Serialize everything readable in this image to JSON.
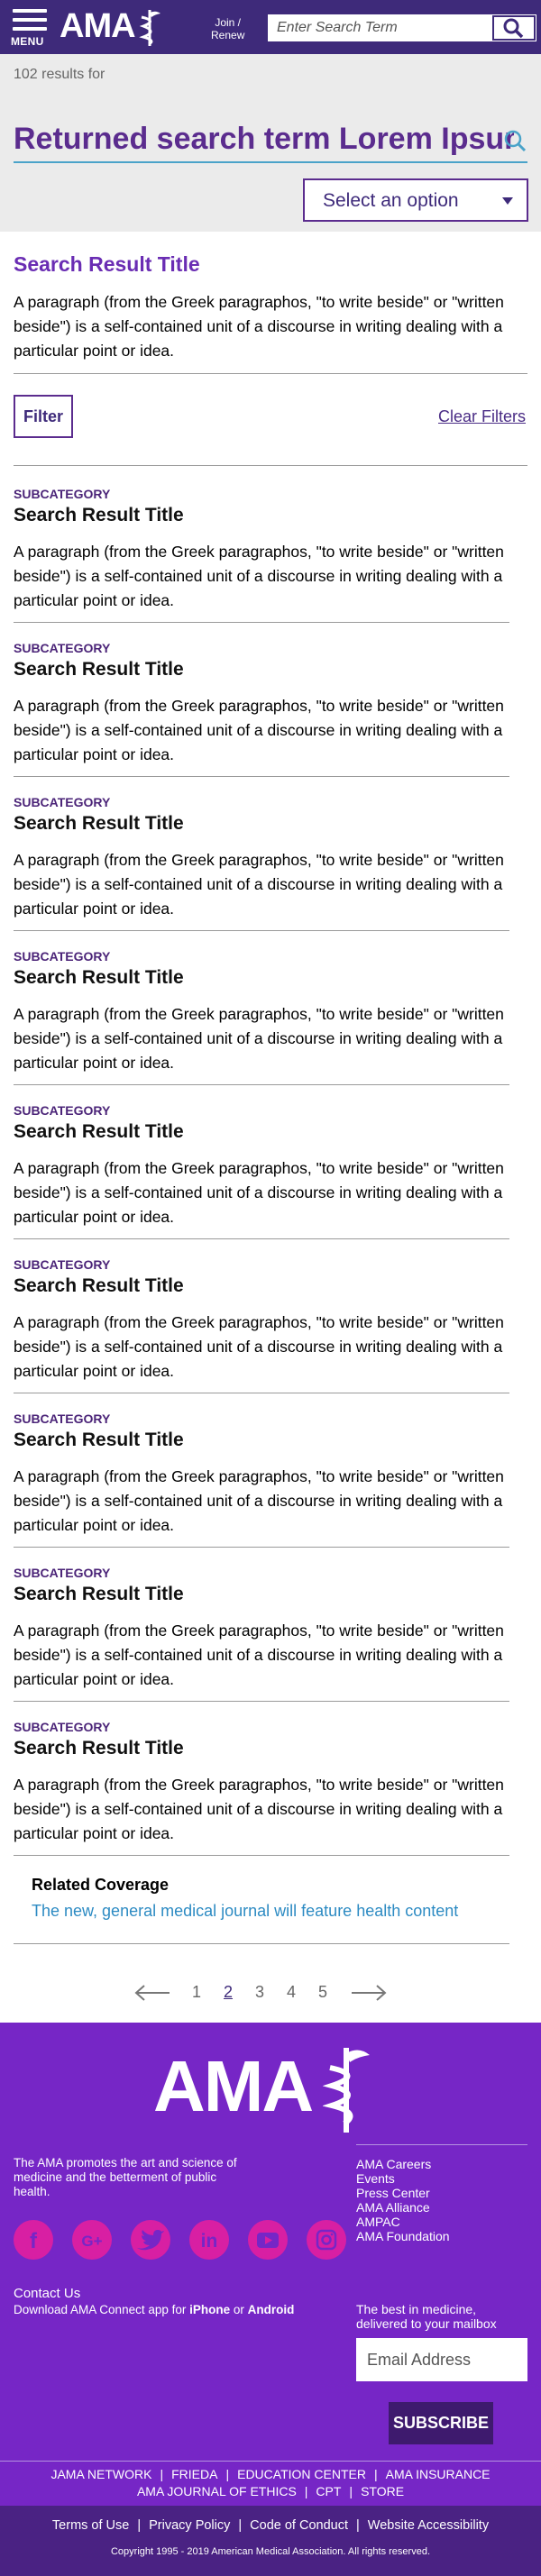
{
  "header": {
    "menu_label": "MENU",
    "logo_text": "AMA",
    "join_line1": "Join /",
    "join_line2": "Renew",
    "search_placeholder": "Enter Search Term"
  },
  "results_header": {
    "count_text": "102 results for",
    "query": "Returned search term Lorem Ipsum",
    "sort_select": "Select an option"
  },
  "featured": {
    "title": "Search Result Title",
    "body": "A paragraph (from the Greek paragraphos, \"to write beside\" or \"written beside\") is a self-contained unit of a discourse in writing dealing with a particular point or idea."
  },
  "filters": {
    "filter_label": "Filter",
    "clear_label": "Clear Filters"
  },
  "results": [
    {
      "subcategory": "SUBCATEGORY",
      "title": "Search Result Title",
      "body": "A paragraph (from the Greek paragraphos, \"to write beside\" or \"written beside\") is a self-contained unit of a discourse in writing dealing with a particular point or idea."
    },
    {
      "subcategory": "SUBCATEGORY",
      "title": "Search Result Title",
      "body": "A paragraph (from the Greek paragraphos, \"to write beside\" or \"written beside\") is a self-contained unit of a discourse in writing dealing with a particular point or idea."
    },
    {
      "subcategory": "SUBCATEGORY",
      "title": "Search Result Title",
      "body": "A paragraph (from the Greek paragraphos, \"to write beside\" or \"written beside\") is a self-contained unit of a discourse in writing dealing with a particular point or idea."
    },
    {
      "subcategory": "SUBCATEGORY",
      "title": "Search Result Title",
      "body": "A paragraph (from the Greek paragraphos, \"to write beside\" or \"written beside\") is a self-contained unit of a discourse in writing dealing with a particular point or idea."
    },
    {
      "subcategory": "SUBCATEGORY",
      "title": "Search Result Title",
      "body": "A paragraph (from the Greek paragraphos, \"to write beside\" or \"written beside\") is a self-contained unit of a discourse in writing dealing with a particular point or idea."
    },
    {
      "subcategory": "SUBCATEGORY",
      "title": "Search Result Title",
      "body": "A paragraph (from the Greek paragraphos, \"to write beside\" or \"written beside\") is a self-contained unit of a discourse in writing dealing with a particular point or idea."
    },
    {
      "subcategory": "SUBCATEGORY",
      "title": "Search Result Title",
      "body": "A paragraph (from the Greek paragraphos, \"to write beside\" or \"written beside\") is a self-contained unit of a discourse in writing dealing with a particular point or idea."
    },
    {
      "subcategory": "SUBCATEGORY",
      "title": "Search Result Title",
      "body": "A paragraph (from the Greek paragraphos, \"to write beside\" or \"written beside\") is a self-contained unit of a discourse in writing dealing with a particular point or idea."
    },
    {
      "subcategory": "SUBCATEGORY",
      "title": "Search Result Title",
      "body": "A paragraph (from the Greek paragraphos, \"to write beside\" or \"written beside\") is a self-contained unit of a discourse in writing dealing with a particular point or idea."
    }
  ],
  "related": {
    "heading": "Related Coverage",
    "link": "The new, general medical journal will feature health content"
  },
  "pagination": {
    "pages": [
      "1",
      "2",
      "3",
      "4",
      "5"
    ],
    "current": "2"
  },
  "footer": {
    "logo_text": "AMA",
    "mission": "The AMA promotes the art and science of medicine and the betterment of public health.",
    "links": [
      "AMA Careers",
      "Events",
      "Press Center",
      "AMA Alliance",
      "AMPAC",
      "AMA Foundation"
    ],
    "social": [
      "facebook-icon",
      "google-plus-icon",
      "twitter-icon",
      "linkedin-icon",
      "youtube-icon",
      "instagram-icon"
    ],
    "contact_us": "Contact Us",
    "download_prefix": "Download AMA Connect app for ",
    "download_iphone": "iPhone",
    "download_or": " or ",
    "download_android": "Android",
    "newsletter_text": "The best in medicine, delivered to your mailbox",
    "email_placeholder": "Email Address",
    "subscribe_label": "SUBSCRIBE",
    "partner_row1": [
      "JAMA NETWORK",
      "FRIEDA",
      "EDUCATION CENTER",
      "AMA INSURANCE"
    ],
    "partner_row2": [
      "AMA JOURNAL OF ETHICS",
      "CPT",
      "STORE"
    ],
    "legal_links": [
      "Terms of Use",
      "Privacy Policy",
      "Code of Conduct",
      "Website Accessibility"
    ],
    "copyright": "Copyright 1995 - 2019 American Medical Association. All rights reserved."
  },
  "colors": {
    "header_bg": "#3e2a7a",
    "accent_purple": "#5b2c8e",
    "link_blue": "#2d8bc3",
    "footer_bg": "#7626c6",
    "social_pink": "#d81fa3",
    "legal_bg": "#4a2283"
  }
}
